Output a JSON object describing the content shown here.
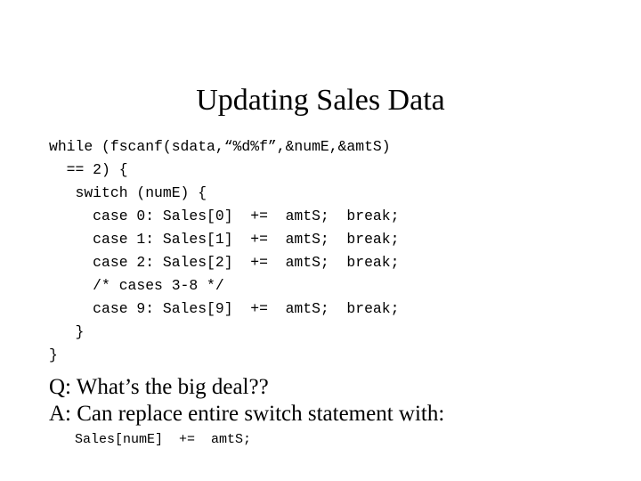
{
  "slide": {
    "title": "Updating Sales Data",
    "background_color": "#ffffff",
    "text_color": "#000000"
  },
  "code_listing": {
    "language": "c",
    "lines": [
      "while (fscanf(sdata,“%d%f”,&numE,&amtS)",
      "  == 2) {",
      "   switch (numE) {",
      "     case 0: Sales[0]  +=  amtS;  break;",
      "     case 1: Sales[1]  +=  amtS;  break;",
      "     case 2: Sales[2]  +=  amtS;  break;",
      "     /* cases 3-8 */",
      "     case 9: Sales[9]  +=  amtS;  break;",
      "   }",
      "}"
    ]
  },
  "qa": {
    "question": "Q: What’s the big deal??",
    "answer": "A: Can replace entire switch statement with:"
  },
  "final_code": {
    "line": "Sales[numE]  +=  amtS;"
  }
}
